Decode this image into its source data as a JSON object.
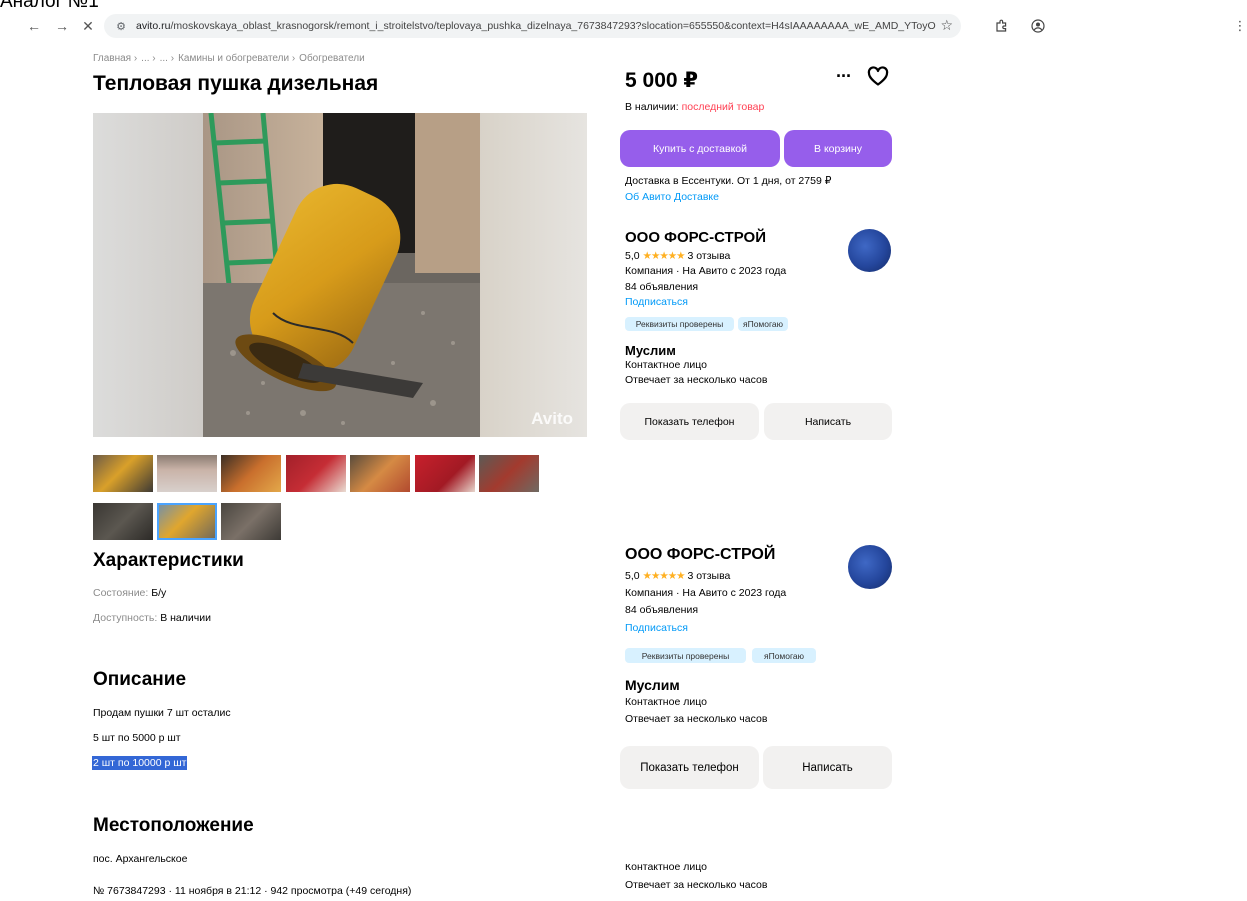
{
  "caption": "Аналог №1",
  "browser": {
    "back_icon": "arrow-left-icon",
    "forward_icon": "arrow-right-icon",
    "close_icon": "close-icon",
    "url_host": "avito.ru",
    "url_path": "/moskovskaya_oblast_krasnogorsk/remont_i_stroitelstvo/teplovaya_pushka_dizelnaya_7673847293?slocation=655550&context=H4sIAAAAAAAA_wE_AMD_YToyOntzOjEzOiJsb2NhbFByaW..."
  },
  "breadcrumb": [
    "Главная ›",
    "... ›",
    "... ›",
    "Камины и обогреватели ›",
    "Обогреватели"
  ],
  "title": "Тепловая пушка дизельная",
  "photo": {
    "watermark": "Avito"
  },
  "characteristics": {
    "heading": "Характеристики",
    "items": [
      {
        "key": "Состояние:",
        "value": "Б/у"
      },
      {
        "key": "Доступность:",
        "value": "В наличии"
      }
    ]
  },
  "description": {
    "heading": "Описание",
    "lines": [
      "Продам пушки 7 шт осталис",
      "5 шт по 5000 р шт",
      "2 шт по 10000 р шт"
    ]
  },
  "location": {
    "heading": "Местоположение",
    "address": "пос. Архангельское"
  },
  "meta_line": "№ 7673847293 · 11 ноября в 21:12 · 942 просмотра (+49 сегодня)",
  "price": "5 000 ₽",
  "more_label": "···",
  "stock": {
    "label": "В наличии:",
    "value": "последний товар"
  },
  "buttons": {
    "buy_delivery": "Купить с доставкой",
    "to_cart": "В корзину",
    "show_phone": "Показать телефон",
    "write": "Написать"
  },
  "delivery": {
    "text": "Доставка в Ессентуки. От 1 дня, от 2759 ₽",
    "link": "Об Авито Доставке"
  },
  "seller": {
    "name": "ООО ФОРС-СТРОЙ",
    "rating": "5,0",
    "stars": "★★★★★",
    "reviews": "3 отзыва",
    "company_line": "Компания · На Авито с 2023 года",
    "ads_count": "84 объявления",
    "subscribe": "Подписаться",
    "badge_verified": "Реквизиты проверены",
    "badge_help": "яПомогаю",
    "contact_name": "Муслим",
    "contact_role": "Контактное лицо",
    "response_time": "Отвечает за несколько часов"
  },
  "tail": {
    "contact_role_cut": "Контактное лицо",
    "response_time": "Отвечает за несколько часов"
  },
  "colors": {
    "purple": "#965eeb",
    "link": "#0099f7",
    "red": "#ff4053",
    "badge_bg": "#d8f1ff",
    "star": "#ffb021"
  }
}
